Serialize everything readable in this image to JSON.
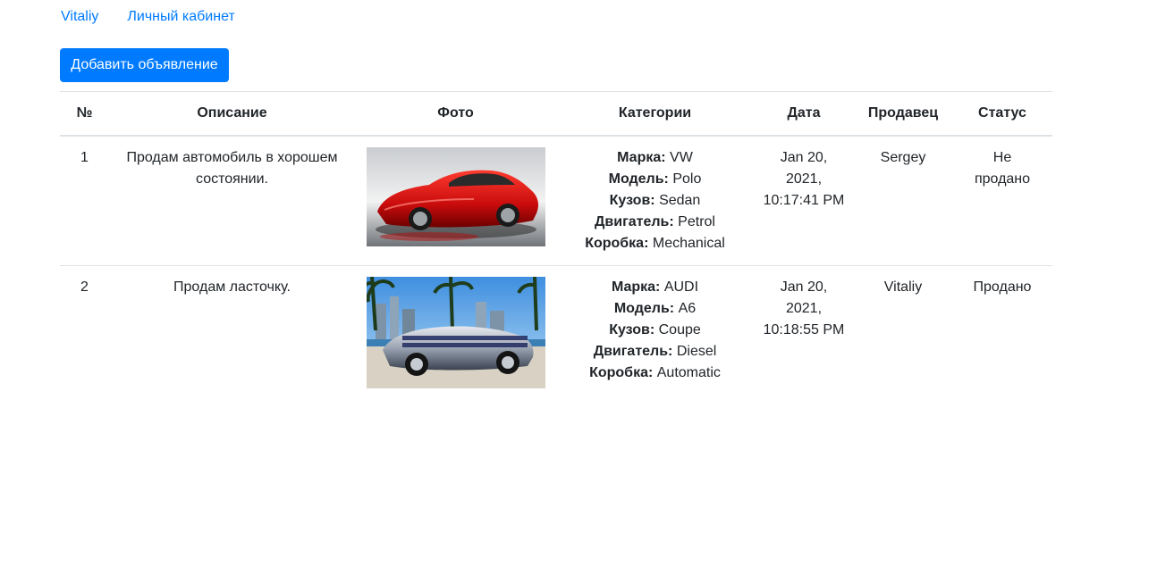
{
  "nav": {
    "user": "Vitaliy",
    "cabinet": "Личный кабинет"
  },
  "toolbar": {
    "add_label": "Добавить объявление"
  },
  "colors": {
    "primary": "#007bff",
    "border": "#dee2e6",
    "text": "#212529"
  },
  "table": {
    "headers": {
      "num": "№",
      "description": "Описание",
      "photo": "Фото",
      "categories": "Категории",
      "date": "Дата",
      "seller": "Продавец",
      "status": "Статус"
    },
    "rows": [
      {
        "num": "1",
        "description": "Продам автомобиль в хорошем состоянии.",
        "photo_icon": "red-sports-car-photo",
        "categories": [
          {
            "label": "Марка:",
            "value": "VW"
          },
          {
            "label": "Модель:",
            "value": "Polo"
          },
          {
            "label": "Кузов:",
            "value": "Sedan"
          },
          {
            "label": "Двигатель:",
            "value": "Petrol"
          },
          {
            "label": "Коробка:",
            "value": "Mechanical"
          }
        ],
        "date": {
          "line1": "Jan 20,",
          "line2": "2021,",
          "line3": "10:17:41 PM"
        },
        "seller": "Sergey",
        "status": {
          "line1": "Не",
          "line2": "продано"
        }
      },
      {
        "num": "2",
        "description": "Продам ласточку.",
        "photo_icon": "blue-convertible-car-photo",
        "categories": [
          {
            "label": "Марка:",
            "value": "AUDI"
          },
          {
            "label": "Модель:",
            "value": "A6"
          },
          {
            "label": "Кузов:",
            "value": "Coupe"
          },
          {
            "label": "Двигатель:",
            "value": "Diesel"
          },
          {
            "label": "Коробка:",
            "value": "Automatic"
          }
        ],
        "date": {
          "line1": "Jan 20,",
          "line2": "2021,",
          "line3": "10:18:55 PM"
        },
        "seller": "Vitaliy",
        "status": {
          "line1": "Продано",
          "line2": ""
        }
      }
    ]
  }
}
